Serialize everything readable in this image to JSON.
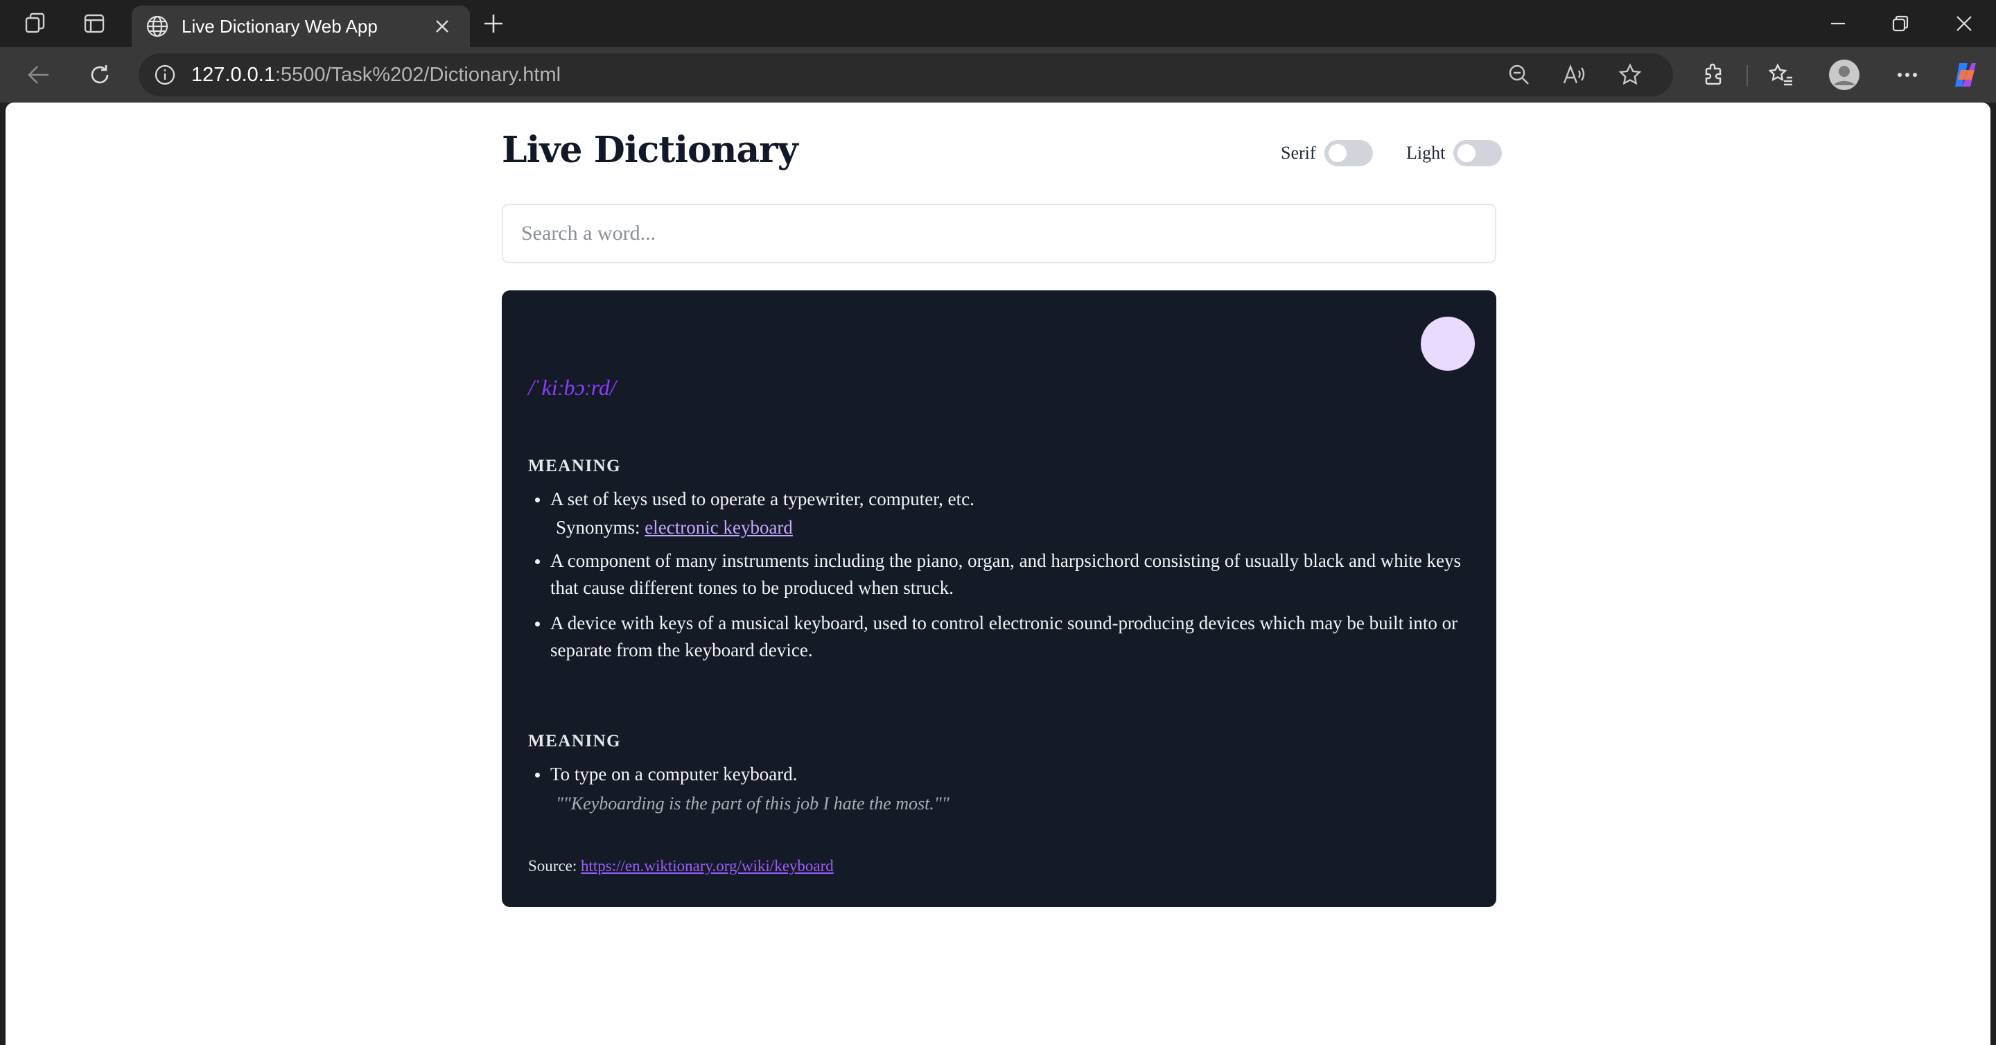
{
  "browser": {
    "tab_title": "Live Dictionary Web App",
    "url_host": "127.0.0.1",
    "url_rest": ":5500/Task%202/Dictionary.html",
    "icons": [
      "workspaces-icon",
      "tab-actions-icon",
      "globe-icon",
      "close-icon",
      "new-tab-icon",
      "minimize-icon",
      "restore-icon",
      "window-close-icon",
      "back-icon",
      "refresh-icon",
      "site-info-icon",
      "zoom-icon",
      "read-aloud-icon",
      "favorite-star-icon",
      "extensions-icon",
      "favorites-icon",
      "profile-icon",
      "more-icon",
      "copilot-icon"
    ]
  },
  "app": {
    "title": "Live Dictionary",
    "font_toggle_label": "Serif",
    "theme_toggle_label": "Light",
    "search_placeholder": "Search a word...",
    "search_value": ""
  },
  "result": {
    "phonetic": "/ˈkiːbɔːrd/",
    "meanings": [
      {
        "label": "MEANING",
        "definitions": [
          {
            "text": "A set of keys used to operate a typewriter, computer, etc.",
            "synonyms_label": "Synonyms:",
            "synonym": "electronic keyboard"
          },
          {
            "text": "A component of many instruments including the piano, organ, and harpsichord consisting of usually black and white keys that cause different tones to be produced when struck."
          },
          {
            "text": "A device with keys of a musical keyboard, used to control electronic sound-producing devices which may be built into or separate from the keyboard device."
          }
        ]
      },
      {
        "label": "MEANING",
        "definitions": [
          {
            "text": "To type on a computer keyboard.",
            "example": "\"\"Keyboarding is the part of this job I hate the most.\"\""
          }
        ]
      }
    ],
    "source_label": "Source:",
    "source_url": "https://en.wiktionary.org/wiki/keyboard"
  },
  "colors": {
    "card_bg": "#151a27",
    "accent": "#8b3dff",
    "play_button": "#e9dbff",
    "title": "#111827"
  }
}
